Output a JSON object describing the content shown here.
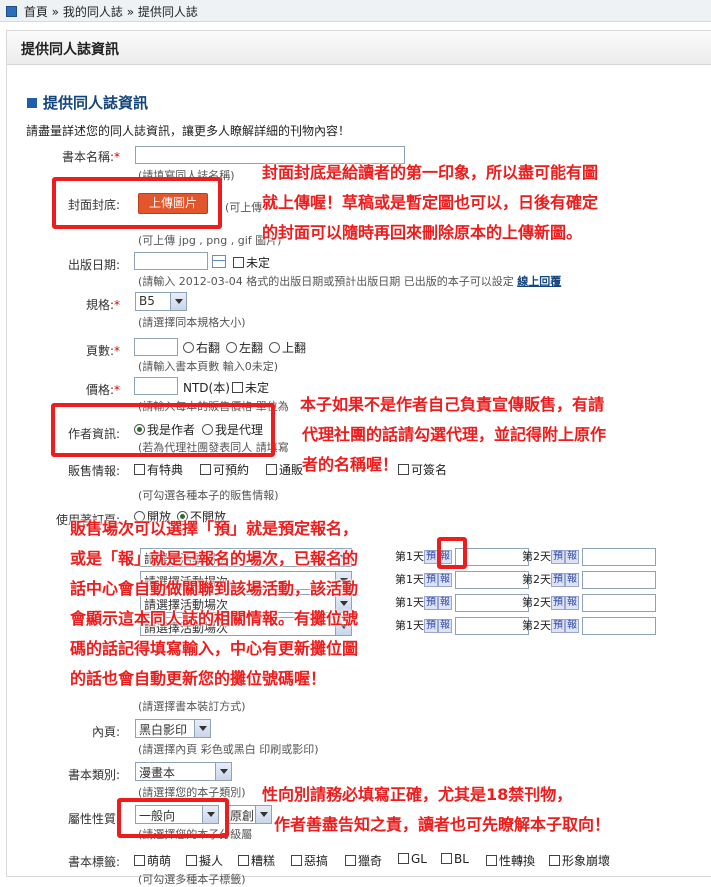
{
  "breadcrumb": {
    "home": "首頁",
    "sep": "»",
    "mine": "我的同人誌",
    "current": "提供同人誌"
  },
  "panel_title": "提供同人誌資訊",
  "section_title": "提供同人誌資訊",
  "intro": "請盡量詳述您的同人誌資訊，讓更多人瞭解詳細的刊物內容！",
  "fields": {
    "book_name": {
      "label": "書本名稱:",
      "hint": "(請填寫同人誌名稱)"
    },
    "cover": {
      "label": "封面封底:",
      "button": "上傳圖片",
      "hint_right": "(可上傳",
      "hint": "(可上傳 jpg , png , gif 圖片)"
    },
    "pub_date": {
      "label": "出版日期:",
      "unset": "未定",
      "hint": "(請輸入 2012-03-04 格式的出版日期或預計出版日期 已出版的本子可以設定",
      "link": "線上回覆"
    },
    "spec": {
      "label": "規格:",
      "value": "B5",
      "hint": "(請選擇同本規格大小)"
    },
    "pages": {
      "label": "頁數:",
      "options": [
        "右翻",
        "左翻",
        "上翻"
      ],
      "hint": "(請輸入書本頁數 輸入0未定)"
    },
    "price": {
      "label": "價格:",
      "unit": "NTD(本)",
      "unset": "未定",
      "hint": "(請輸入每本的販售價格 單位為"
    },
    "author": {
      "label": "作者資訊:",
      "options": [
        "我是作者",
        "我是代理"
      ],
      "hint": "(若為代理社團發表同人 請填寫"
    },
    "sale": {
      "label": "販售情報:",
      "options": [
        "有特典",
        "可預約",
        "通販",
        "可簽名"
      ],
      "hint": "(可勾選各種本子的販售情報)"
    },
    "use": {
      "label": "使用著訂頁:",
      "options": [
        "開放",
        "不開放"
      ]
    },
    "inner": {
      "label": "內頁:",
      "value": "黑白影印",
      "hint": "(請選擇內頁 彩色或黑白 印刷或影印)"
    },
    "binding_hint": "(請選擇書本裝訂方式)",
    "category": {
      "label": "書本類別:",
      "value": "漫畫本",
      "hint": "(請選擇您的本子類別)"
    },
    "rating": {
      "label": "屬性性質:",
      "value": "一般向",
      "value2": "原創",
      "hint": "(請選擇您的本子分級屬"
    },
    "tags": {
      "label": "書本標籤:",
      "options": [
        "萌萌",
        "擬人",
        "糟糕",
        "惡搞",
        "獵奇",
        "GL",
        "BL",
        "性轉換",
        "形象崩壞"
      ],
      "hint": "(可勾選多種本子標籤)"
    }
  },
  "events": {
    "select_placeholder": "請選擇活動場次",
    "day1": "第1天",
    "day2": "第2天",
    "pre": "預",
    "reg": "報"
  },
  "annotations": {
    "cover": [
      "封面封底是給讀者的第一印象，所以盡可能有圖",
      "就上傳喔！草稿或是暫定圖也可以，日後有確定",
      "的封面可以隨時再回來刪除原本的上傳新圖。"
    ],
    "author": [
      "本子如果不是作者自己負責宣傳販售，有請",
      "代理社團的話請勾選代理，並記得附上原作",
      "者的名稱喔！"
    ],
    "event": [
      "販售場次可以選擇「預」就是預定報名，",
      "或是「報」就是已報名的場次，已報名的",
      "話中心會自動做關聯到該場活動，該活動",
      "會顯示這本同人誌的相關情報。有攤位號",
      "碼的話記得填寫輸入，中心有更新攤位圖",
      "的話也會自動更新您的攤位號碼喔！"
    ],
    "rating": [
      "性向別請務必填寫正確，尤其是18禁刊物，",
      "作者善盡告知之責，讀者也可先瞭解本子取向！"
    ]
  },
  "colors": {
    "annotation": "#ee1c1c",
    "upload_button": "#e2562d",
    "section_title": "#12457c"
  }
}
